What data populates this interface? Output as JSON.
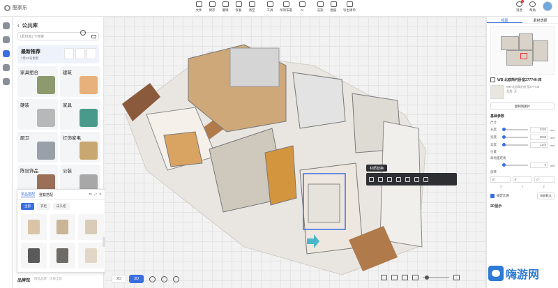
{
  "app": {
    "name": "酷家乐"
  },
  "toolbar": {
    "items": [
      {
        "label": "文件"
      },
      {
        "label": "保存"
      },
      {
        "label": "撤销"
      },
      {
        "label": "恢复"
      },
      {
        "label": "清空"
      },
      {
        "label": "工具"
      },
      {
        "label": "吊顶布置"
      },
      {
        "label": "AI"
      },
      {
        "label": "渲染"
      },
      {
        "label": "图册"
      },
      {
        "label": "导出清单"
      }
    ],
    "right": [
      {
        "label": "消息"
      },
      {
        "label": "帮助"
      }
    ]
  },
  "library": {
    "title": "公共库",
    "search_placeholder": "[素材库] 下搜索",
    "promo": {
      "title": "最新推荐",
      "subtitle": "7月10号更新"
    },
    "categories": [
      {
        "label": "家具组合",
        "color": "#8c9a6e"
      },
      {
        "label": "建筑",
        "color": "#e8b07a"
      },
      {
        "label": "硬装",
        "color": "#b8b8b8"
      },
      {
        "label": "家具",
        "color": "#4a9a8c"
      },
      {
        "label": "厨卫",
        "color": "#9aa0a8"
      },
      {
        "label": "灯饰家电",
        "color": "#c8a870"
      },
      {
        "label": "陈设饰品",
        "color": "#9a7058"
      },
      {
        "label": "公装",
        "color": "#a8a8a8"
      }
    ],
    "footer": {
      "label": "品牌馆",
      "hint": "精选品牌 · 优质全屋"
    }
  },
  "popup": {
    "tabs": [
      "单品搭配",
      "整套搭配"
    ],
    "chips": [
      "全部",
      "衣柜",
      "床头柜"
    ],
    "items": [
      {
        "color": "#d9c4a8"
      },
      {
        "color": "#c9b496"
      },
      {
        "color": "#d8cbb8"
      },
      {
        "color": "#5a5a5a"
      },
      {
        "color": "#6e6a66"
      },
      {
        "color": "#e2d6c6"
      }
    ]
  },
  "canvas": {
    "context_label": "材质替换",
    "view_modes": [
      "2D",
      "3D"
    ]
  },
  "right_panel": {
    "tabs": [
      "视图",
      "素材选择"
    ],
    "object": {
      "title": "WB-北欧简约卧室277746-床",
      "line1": "WB-北欧简约卧室277746",
      "line2": "品类: 无"
    },
    "replace_button": "复制到图片",
    "section_basic": "基础参数",
    "size_label": "尺寸",
    "dims": [
      {
        "label": "长度",
        "value": "2220",
        "unit": "mm"
      },
      {
        "label": "宽度",
        "value": "2568",
        "unit": "mm"
      },
      {
        "label": "高度",
        "value": "1178",
        "unit": "mm"
      }
    ],
    "position_label": "位置",
    "ground_label": "离地面距离",
    "ground_value": "0",
    "ground_unit": "mm",
    "rotation_label": "旋转",
    "rotation": [
      {
        "v": "0°"
      },
      {
        "v": "0°"
      },
      {
        "v": "0°"
      }
    ],
    "axes": [
      "X",
      "Y",
      "Z"
    ],
    "lock_label": "锁定比例",
    "reset_label": "恢复默认",
    "section_2d": "2D显示"
  },
  "watermark": {
    "text": "嗨游网"
  },
  "colors": {
    "accent": "#3b6fe0",
    "dark": "#2d2f33"
  }
}
